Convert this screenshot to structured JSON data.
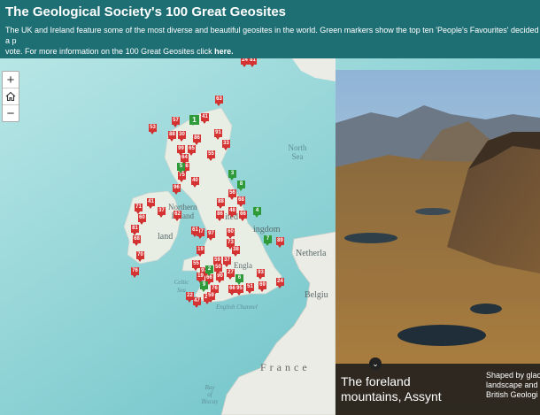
{
  "header": {
    "title": "The Geological Society's 100 Great Geosites",
    "desc_line1": "The UK and Ireland feature some of the most diverse and beautiful geosites in the world. Green markers show the top ten 'People's Favourites' decided by a p",
    "desc_line2": "vote. For more information on the 100 Great Geosites click ",
    "link": "here."
  },
  "controls": {
    "zoom_in": "+",
    "home_icon": "home-icon",
    "zoom_out": "−"
  },
  "map_labels": {
    "north_sea": [
      "North",
      "Sea"
    ],
    "northern_ireland": [
      "Northern",
      "Ireland"
    ],
    "ireland_partial": "land",
    "kingdom_partial": "ingdom",
    "united_partial": "ited",
    "netherlands": "Netherla",
    "belgium": "Belgiu",
    "england": "Engla",
    "celtic_sea": [
      "Celtic",
      "Sea"
    ],
    "english_channel": "English Channel",
    "france": "France",
    "bay": [
      "Bay",
      "of",
      "Biscay"
    ]
  },
  "markers_red": [
    "24",
    "81",
    "63",
    "57",
    "53",
    "41",
    "88",
    "30",
    "86",
    "91",
    "33",
    "99",
    "65",
    "55",
    "64",
    "75",
    "40",
    "98",
    "96",
    "56",
    "68",
    "88",
    "48",
    "66",
    "71",
    "41",
    "37",
    "60",
    "81",
    "68",
    "62",
    "86",
    "37",
    "97",
    "73",
    "38",
    "76",
    "55",
    "59",
    "37",
    "97",
    "90",
    "66",
    "50",
    "27",
    "93",
    "22",
    "47",
    "19",
    "76",
    "66",
    "51",
    "69",
    "24",
    "95",
    "21",
    "61",
    "60",
    "89",
    "70",
    "19",
    "59"
  ],
  "markers_green": [
    "1",
    "5",
    "3",
    "8",
    "4",
    "7",
    "2",
    "6",
    "9"
  ],
  "feature": {
    "title": "The foreland mountains, Assynt",
    "desc_lines": [
      "Shaped by glac",
      "landscape and",
      "British Geologi"
    ]
  },
  "colors": {
    "header_bg": "#1e6f74",
    "marker_red": "#d53232",
    "marker_green": "#2f9a3a",
    "sea": "#b7e3e4"
  }
}
